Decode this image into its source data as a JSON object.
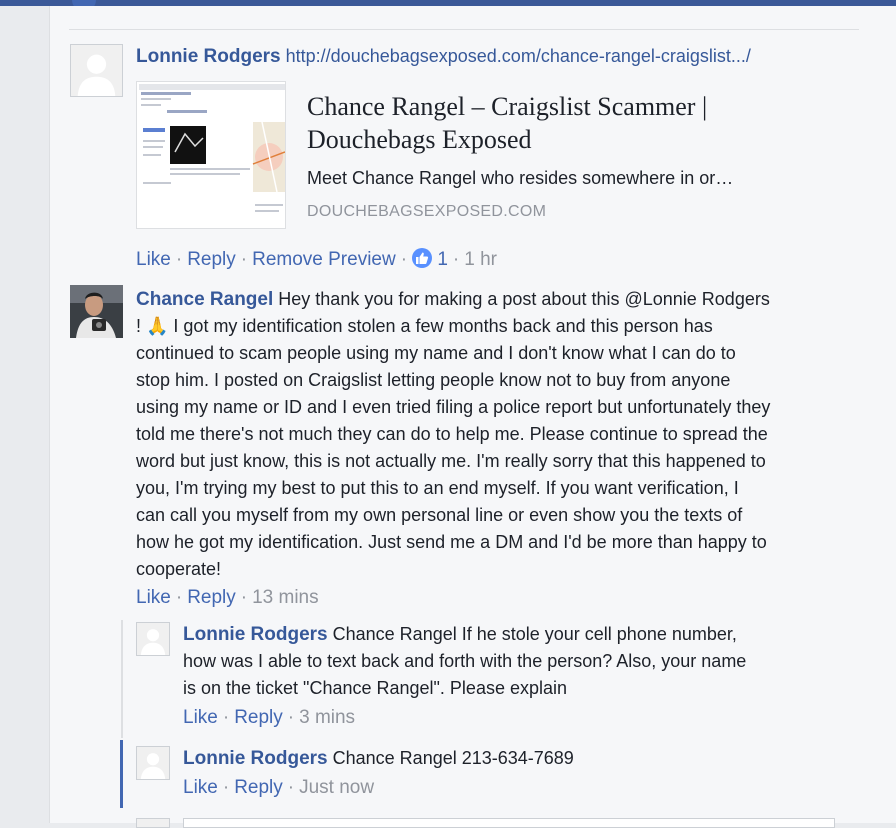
{
  "post": {
    "author": "Lonnie Rodgers",
    "link_text": "http://douchebagsexposed.com/chance-rangel-craigslist.../",
    "preview": {
      "title_line1": "Chance Rangel – Craigslist Scammer |",
      "title_line2": "Douchebags Exposed",
      "description": "Meet Chance Rangel who resides somewhere in or…",
      "domain": "DOUCHEBAGSEXPOSED.COM"
    },
    "actions": {
      "like": "Like",
      "reply": "Reply",
      "remove_preview": "Remove Preview",
      "like_count": "1",
      "time": "1 hr"
    }
  },
  "comment": {
    "author": "Chance Rangel",
    "lines": [
      "Hey thank you for making a post about this @Lonnie Rodgers",
      "! 🙏 I got my identification stolen a few months back and this person has",
      "continued to scam people using my name and I don't know what I can do to",
      "stop him. I posted on Craigslist letting people know not to buy from anyone",
      "using my name or ID and I even tried filing a police report but unfortunately they",
      "told me there's not much they can do to help me. Please continue to spread the",
      "word but just know, this is not actually me. I'm really sorry that this happened to",
      "you, I'm trying my best to put this to an end myself. If you want verification, I",
      "can call you myself from my own personal line or even show you the texts of",
      "how he got my identification. Just send me a DM and I'd be more than happy to",
      "cooperate!"
    ],
    "actions": {
      "like": "Like",
      "reply": "Reply",
      "time": "13 mins"
    }
  },
  "replies": [
    {
      "author": "Lonnie Rodgers",
      "lines": [
        "Chance Rangel If he stole your cell phone number,",
        "how was I able to text back and forth with the person? Also, your name",
        "is on the ticket \"Chance Rangel\". Please explain"
      ],
      "actions": {
        "like": "Like",
        "reply": "Reply",
        "time": "3 mins"
      }
    },
    {
      "author": "Lonnie Rodgers",
      "lines": [
        "Chance Rangel 213-634-7689"
      ],
      "actions": {
        "like": "Like",
        "reply": "Reply",
        "time": "Just now"
      }
    }
  ],
  "colors": {
    "name_blue": "#365899",
    "action_blue": "#4267b2",
    "meta_gray": "#90949c",
    "like_badge": "#5890ff"
  }
}
